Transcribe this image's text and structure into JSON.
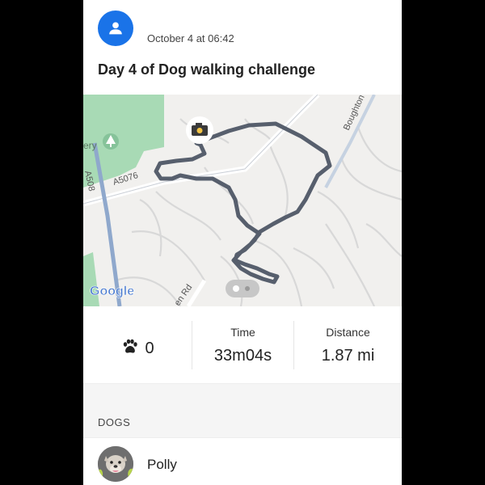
{
  "post": {
    "date": "October 4 at 06:42",
    "title": "Day 4 of Dog walking challenge"
  },
  "map": {
    "labels": {
      "road_a5076": "A5076",
      "road_a508": "A508",
      "road_boughton": "Boughton",
      "road_rd": "en Rd",
      "park": "ery",
      "google": "Google"
    },
    "route_color": "#4e5665",
    "park_color": "#a8dab5",
    "pin_icon": "camera-icon",
    "tree_icon": "tree-icon"
  },
  "stats": {
    "paws_value": "0",
    "paw_icon": "paw-icon",
    "time_label": "Time",
    "time_value": "33m04s",
    "distance_label": "Distance",
    "distance_value": "1.87 mi"
  },
  "dogs": {
    "section_title": "DOGS",
    "items": [
      {
        "name": "Polly"
      }
    ]
  }
}
